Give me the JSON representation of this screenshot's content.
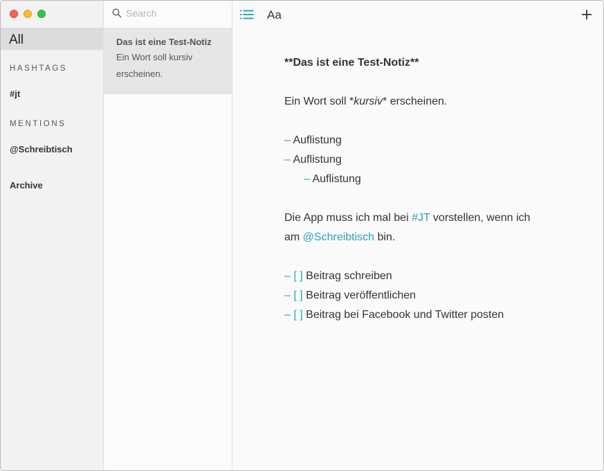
{
  "sidebar": {
    "all_label": "All",
    "hashtags_heading": "HASHTAGS",
    "hashtags": [
      "#jt"
    ],
    "mentions_heading": "MENTIONS",
    "mentions": [
      "@Schreibtisch"
    ],
    "archive_label": "Archive"
  },
  "notelist": {
    "search_placeholder": "Search",
    "notes": [
      {
        "title": "Das ist eine Test-Notiz",
        "snippet": "Ein Wort soll kursiv erscheinen."
      }
    ]
  },
  "toolbar": {
    "font_label": "Aa"
  },
  "editor": {
    "title_prefix": "**",
    "title_text": "Das ist eine Test-Notiz",
    "title_suffix": "**",
    "p1_before": "Ein Wort soll ",
    "p1_marker_open": "*",
    "p1_italic": "kursiv",
    "p1_marker_close": "*",
    "p1_after": " erscheinen.",
    "bullet_marker": "–",
    "bullets": [
      "Auflistung",
      "Auflistung",
      "Auflistung"
    ],
    "p2_line1_before": "Die App muss ich mal bei ",
    "p2_hashtag": "#JT",
    "p2_line1_after": " vorstellen, wenn ich",
    "p2_line2_before": "am ",
    "p2_mention": "@Schreibtisch",
    "p2_line2_after": " bin.",
    "todo_marker": "– [  ]",
    "todos": [
      "Beitrag schreiben",
      "Beitrag veröffentlichen",
      "Beitrag bei Facebook und Twitter posten"
    ]
  },
  "colors": {
    "accent": "#2aa3b5",
    "selected_bg": "#dcdcdc",
    "note_selected_bg": "#e6e6e6"
  }
}
